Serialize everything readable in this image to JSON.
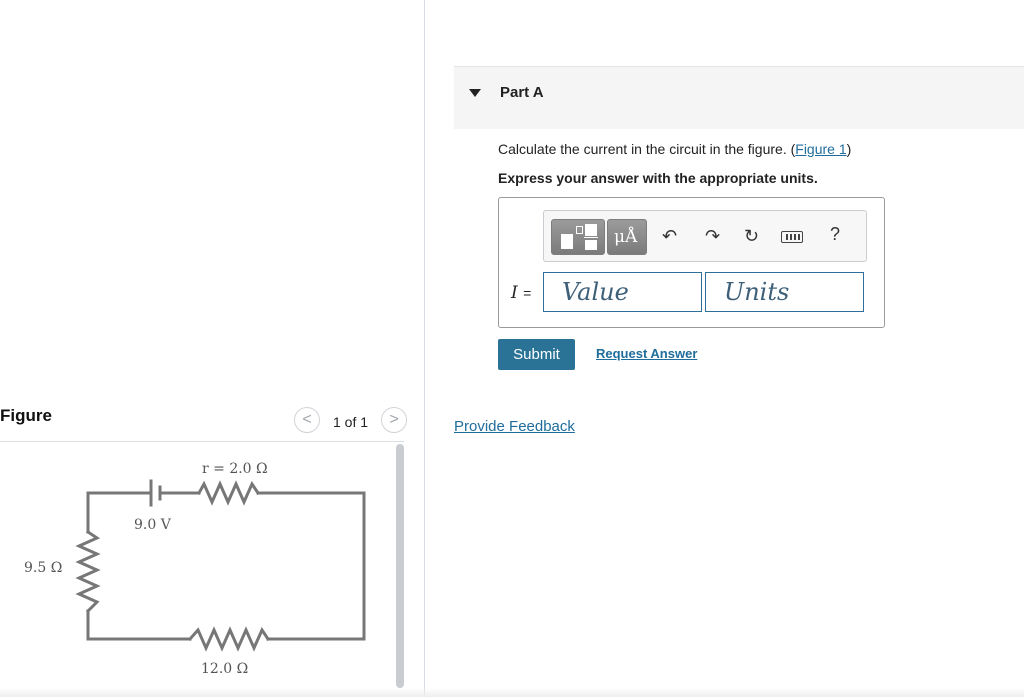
{
  "part": {
    "title": "Part A"
  },
  "question": {
    "text": "Calculate the current in the circuit in the figure. (",
    "figure_link": "Figure 1",
    "text_end": ")",
    "instruction": "Express your answer with the appropriate units."
  },
  "toolbar": {
    "templates_icon": "templates-icon",
    "units_label": "μÅ",
    "undo_icon": "undo-icon",
    "redo_icon": "redo-icon",
    "reset_icon": "reset-icon",
    "keyboard_icon": "keyboard-icon",
    "help_label": "?"
  },
  "answer": {
    "variable": "I",
    "equals": "=",
    "value_placeholder": "Value",
    "units_placeholder": "Units"
  },
  "actions": {
    "submit": "Submit",
    "request_answer": "Request Answer",
    "provide_feedback": "Provide Feedback"
  },
  "figure": {
    "title": "Figure",
    "pager": "1 of 1",
    "prev_icon": "chevron-left-icon",
    "next_icon": "chevron-right-icon",
    "labels": {
      "internal_resistance": "r = 2.0 Ω",
      "emf": "9.0 V",
      "left_resistor": "9.5 Ω",
      "bottom_resistor": "12.0 Ω"
    }
  },
  "colors": {
    "link": "#1f6d9c",
    "submit_bg": "#2a7397",
    "input_border": "#2e6f9a"
  }
}
